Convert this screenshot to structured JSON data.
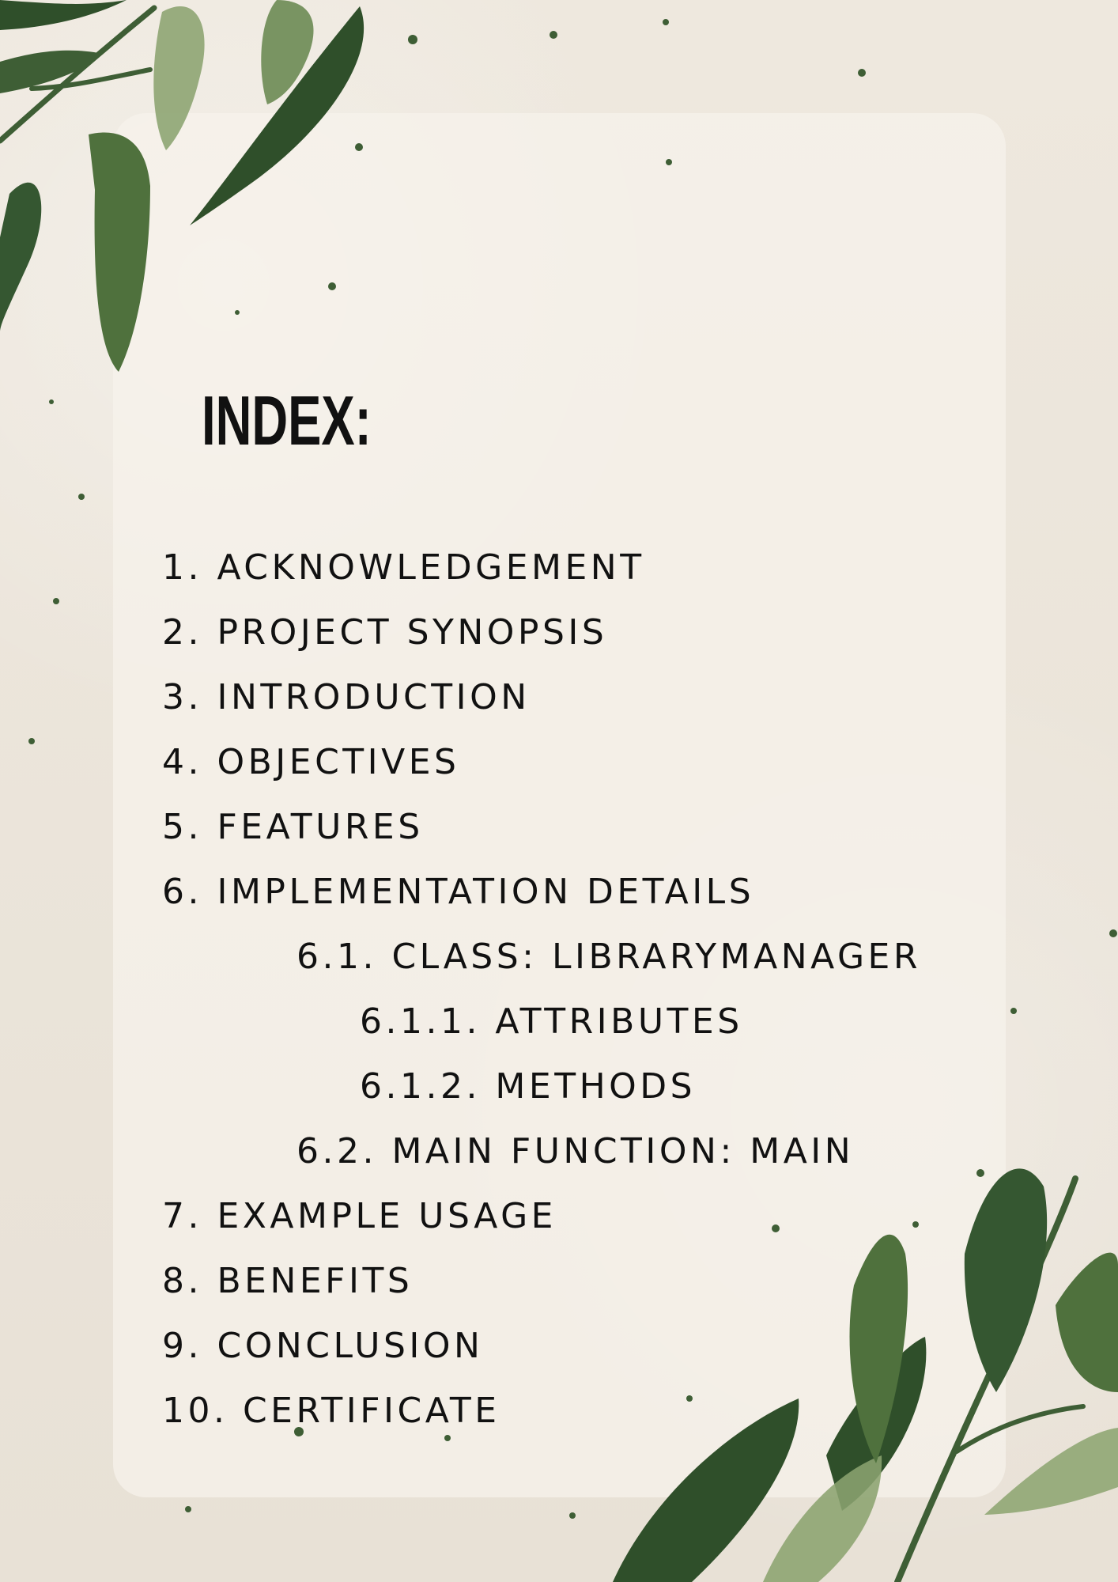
{
  "title": "INDEX:",
  "items": [
    {
      "label": "1. ACKNOWLEDGEMENT",
      "level": 1
    },
    {
      "label": "2. PROJECT SYNOPSIS",
      "level": 1
    },
    {
      "label": "3. INTRODUCTION",
      "level": 1
    },
    {
      "label": "4. OBJECTIVES",
      "level": 1
    },
    {
      "label": "5. FEATURES",
      "level": 1
    },
    {
      "label": "6. IMPLEMENTATION DETAILS",
      "level": 1
    },
    {
      "label": "6.1. CLASS: LIBRARYMANAGER",
      "level": 2
    },
    {
      "label": "6.1.1. ATTRIBUTES",
      "level": 3
    },
    {
      "label": "6.1.2. METHODS",
      "level": 3
    },
    {
      "label": "6.2. MAIN FUNCTION: MAIN",
      "level": 2
    },
    {
      "label": "7. EXAMPLE USAGE",
      "level": 1
    },
    {
      "label": "8. BENEFITS",
      "level": 1
    },
    {
      "label": "9. CONCLUSION",
      "level": 1
    },
    {
      "label": "10. CERTIFICATE",
      "level": 1
    }
  ],
  "colors": {
    "background": "#ece6dc",
    "panel": "#f6f2ec",
    "text": "#111111",
    "leaf_dark": "#2f4f2a",
    "leaf_mid": "#50763f",
    "leaf_light": "#8ba36f"
  },
  "decorations": {
    "top_left": "leaf-branch-icon",
    "bottom_right": "leaf-branch-icon",
    "speckles": "paint-speckles-icon"
  }
}
